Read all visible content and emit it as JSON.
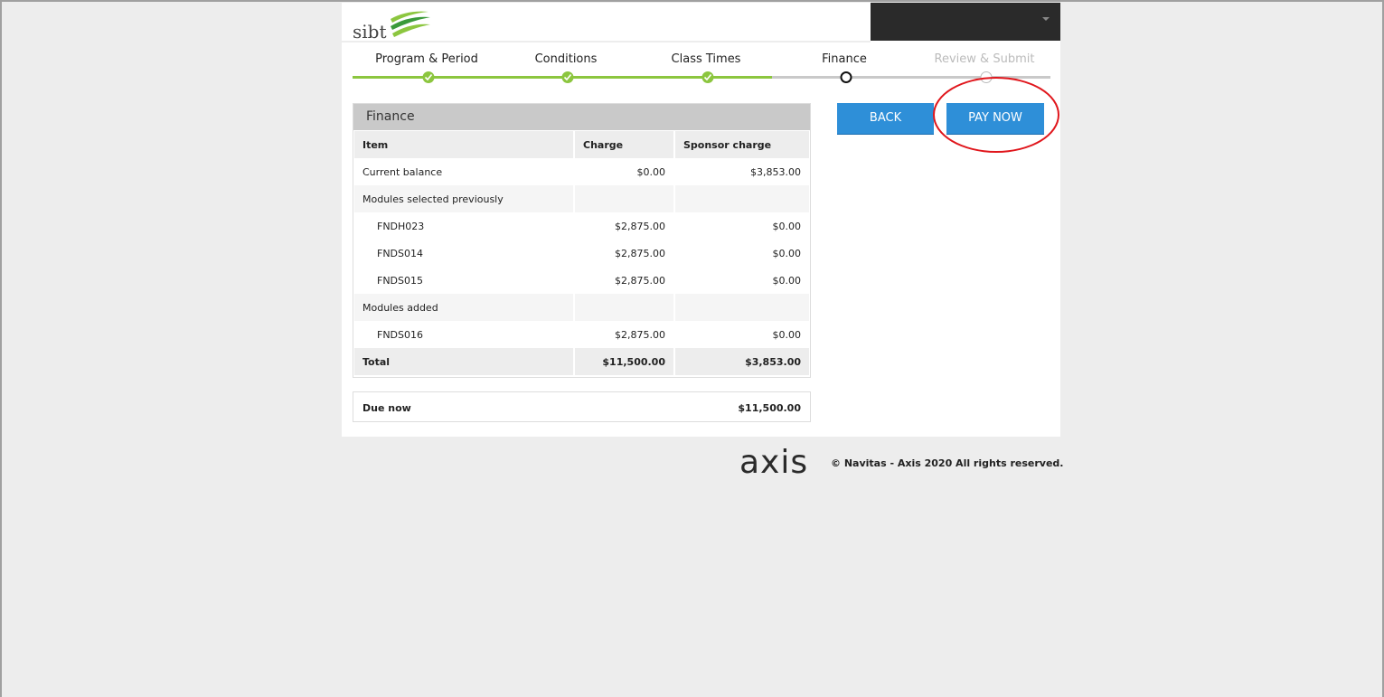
{
  "header": {
    "logo_text": "sibt",
    "accent": "#8cc63f",
    "dark_bar": "#2a2a2a"
  },
  "stepper": {
    "steps": [
      {
        "label": "Program & Period",
        "state": "done"
      },
      {
        "label": "Conditions",
        "state": "done"
      },
      {
        "label": "Class Times",
        "state": "done"
      },
      {
        "label": "Finance",
        "state": "current"
      },
      {
        "label": "Review & Submit",
        "state": "future"
      }
    ]
  },
  "finance": {
    "title": "Finance",
    "columns": [
      "Item",
      "Charge",
      "Sponsor charge"
    ],
    "rows": [
      {
        "item": "Current balance",
        "charge": "$0.00",
        "sponsor": "$3,853.00"
      },
      {
        "item": "Modules selected previously",
        "charge": "",
        "sponsor": ""
      },
      {
        "item": "FNDH023",
        "charge": "$2,875.00",
        "sponsor": "$0.00"
      },
      {
        "item": "FNDS014",
        "charge": "$2,875.00",
        "sponsor": "$0.00"
      },
      {
        "item": "FNDS015",
        "charge": "$2,875.00",
        "sponsor": "$0.00"
      },
      {
        "item": "Modules added",
        "charge": "",
        "sponsor": ""
      },
      {
        "item": "FNDS016",
        "charge": "$2,875.00",
        "sponsor": "$0.00"
      }
    ],
    "total": {
      "label": "Total",
      "charge": "$11,500.00",
      "sponsor": "$3,853.00"
    },
    "due": {
      "label": "Due now",
      "value": "$11,500.00"
    }
  },
  "actions": {
    "back_label": "BACK",
    "pay_label": "PAY NOW",
    "button_color": "#2e8fd8",
    "highlight_color": "#e0161c"
  },
  "footer": {
    "logo": "axis",
    "copyright": "© Navitas - Axis 2020 All rights reserved."
  }
}
